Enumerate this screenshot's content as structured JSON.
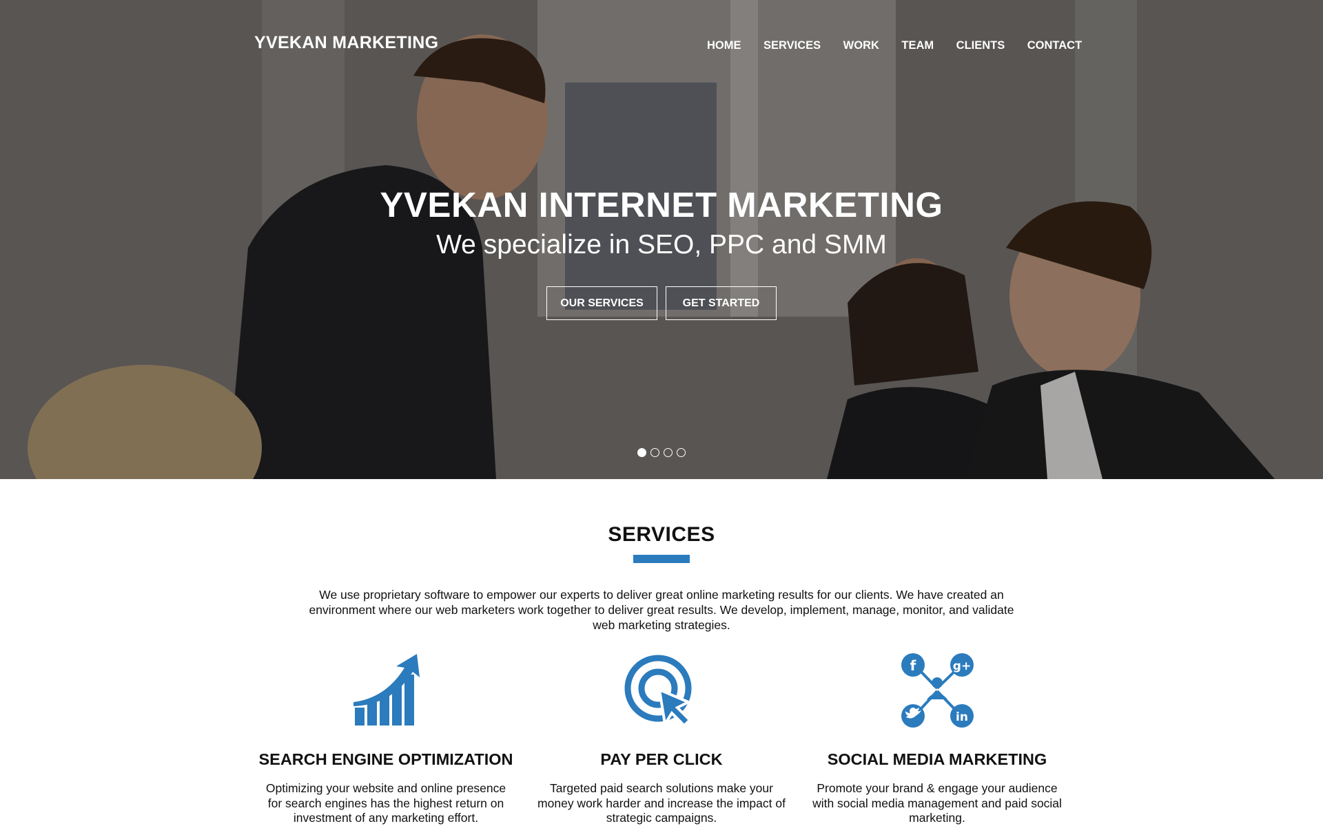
{
  "header": {
    "brand": "YVEKAN MARKETING",
    "nav": [
      "HOME",
      "SERVICES",
      "WORK",
      "TEAM",
      "CLIENTS",
      "CONTACT"
    ]
  },
  "hero": {
    "title": "YVEKAN INTERNET MARKETING",
    "subtitle": "We specialize in SEO, PPC and SMM",
    "buttons": {
      "services": "OUR SERVICES",
      "start": "GET STARTED"
    },
    "slides": {
      "count": 4,
      "active": 1
    }
  },
  "services": {
    "title": "SERVICES",
    "intro": "We use proprietary software to empower our experts to deliver great online marketing results for our clients. We have created an environment where our web marketers  work together to deliver great results. We develop, implement, manage, monitor, and validate web marketing strategies.",
    "items": [
      {
        "icon": "growth-chart-icon",
        "title": "SEARCH ENGINE OPTIMIZATION",
        "text": "Optimizing your website and online presence for search engines has the highest return  on investment of any marketing effort."
      },
      {
        "icon": "target-cursor-icon",
        "title": "PAY PER CLICK",
        "text": "Targeted paid search solutions make your money work harder and increase the impact of strategic campaigns."
      },
      {
        "icon": "social-network-icon",
        "title": "SOCIAL MEDIA MARKETING",
        "text": "Promote your brand & engage your audience with social media management and paid social marketing."
      }
    ]
  },
  "colors": {
    "accent": "#2b7bbd",
    "hero_text": "#ffffff",
    "body_text": "#111111"
  }
}
